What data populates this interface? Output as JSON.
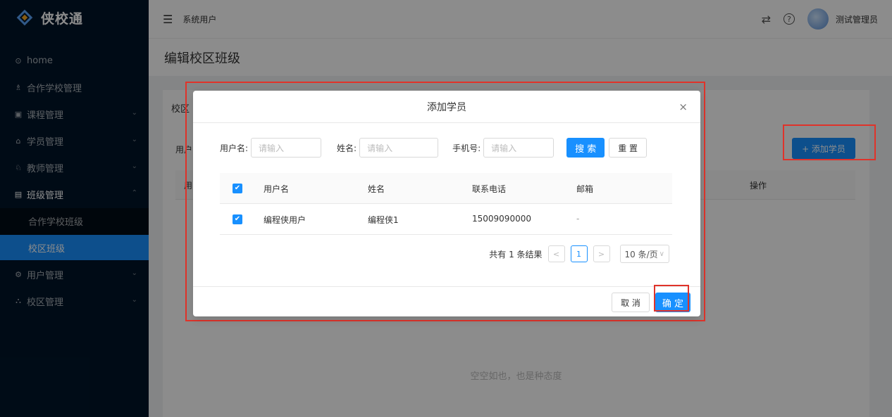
{
  "app": {
    "name": "侠校通"
  },
  "sidebar": {
    "items": [
      {
        "label": "home",
        "icon": "⊙"
      },
      {
        "label": "合作学校管理",
        "icon": "♗"
      },
      {
        "label": "课程管理",
        "icon": "▣",
        "chev": "⌄"
      },
      {
        "label": "学员管理",
        "icon": "⌂",
        "chev": "⌄"
      },
      {
        "label": "教师管理",
        "icon": "♘",
        "chev": "⌄"
      },
      {
        "label": "班级管理",
        "icon": "▤",
        "chev": "⌃"
      }
    ],
    "submenu": [
      {
        "label": "合作学校班级"
      },
      {
        "label": "校区班级"
      }
    ],
    "items_after": [
      {
        "label": "用户管理",
        "icon": "⚙",
        "chev": "⌄"
      },
      {
        "label": "校区管理",
        "icon": "⛬",
        "chev": "⌄"
      }
    ]
  },
  "header": {
    "breadcrumb": "系统用户",
    "swap_icon": "⇄",
    "help_icon": "?",
    "username": "测试管理员"
  },
  "page": {
    "title": "编辑校区班级",
    "card_tab": "校区",
    "card_label": "用户",
    "add_student_button": "+ 添加学员",
    "table_first_col": "用",
    "table_op_col": "操作",
    "empty_text": "空空如也，也是种态度"
  },
  "modal": {
    "title": "添加学员",
    "close": "×",
    "search": {
      "username_label": "用户名:",
      "username_placeholder": "请输入",
      "name_label": "姓名:",
      "name_placeholder": "请输入",
      "phone_label": "手机号:",
      "phone_placeholder": "请输入",
      "search_button": "搜 索",
      "reset_button": "重 置"
    },
    "table": {
      "columns": [
        "用户名",
        "姓名",
        "联系电话",
        "邮箱"
      ],
      "rows": [
        {
          "username": "编程侠用户",
          "name": "编程侠1",
          "phone": "15009090000",
          "email": "-"
        }
      ]
    },
    "pagination": {
      "total_text": "共有 1 条结果",
      "prev": "<",
      "page": "1",
      "next": ">",
      "page_size": "10 条/页"
    },
    "footer": {
      "cancel_button": "取 消",
      "confirm_button": "确 定"
    }
  },
  "colors": {
    "primary": "#1890ff",
    "sidebar_bg": "#001529",
    "annotation": "#e0332a"
  }
}
